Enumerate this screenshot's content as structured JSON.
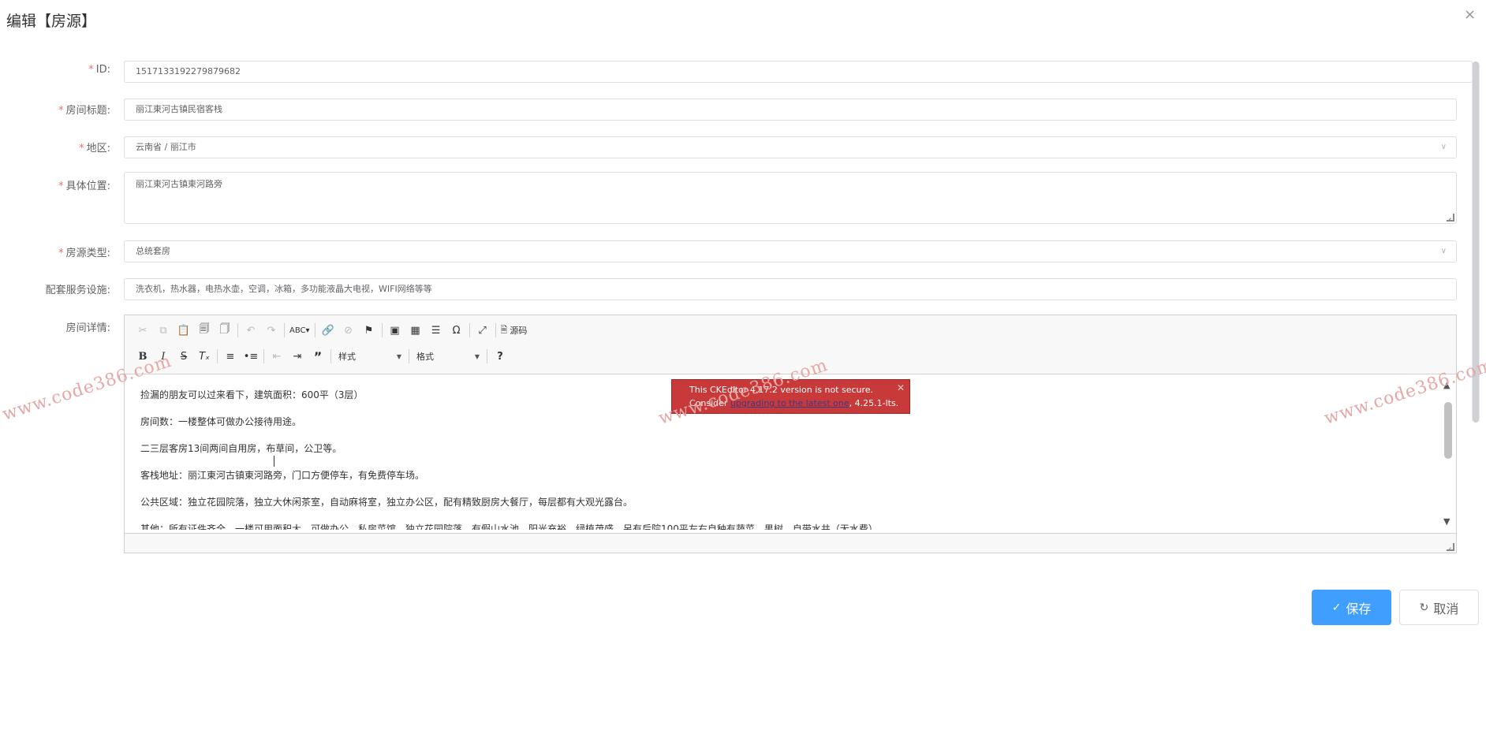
{
  "dialog": {
    "title": "编辑【房源】",
    "close_glyph": "×"
  },
  "form": {
    "required_mark": "*",
    "id": {
      "label": "ID:",
      "value": "1517133192279879682"
    },
    "room_title": {
      "label": "房间标题:",
      "value": "丽江東河古镇民宿客栈"
    },
    "region": {
      "label": "地区:",
      "value": "云南省 / 丽江市"
    },
    "address": {
      "label": "具体位置:",
      "value": "丽江東河古镇東河路旁"
    },
    "room_type": {
      "label": "房源类型:",
      "value": "总统套房"
    },
    "facilities": {
      "label": "配套服务设施:",
      "value": "洗衣机，热水器，电热水壶，空调，冰箱，多功能液晶大电视，WIFI网络等等"
    },
    "details": {
      "label": "房间详情:"
    }
  },
  "editor": {
    "toolbar": {
      "source_label": "源码",
      "styles_label": "样式",
      "format_label": "格式",
      "help_glyph": "?"
    },
    "content_lines": [
      "捡漏的朋友可以过来看下，建筑面积：600平（3层）",
      "房间数：一楼整体可做办公接待用途。",
      "二三层客房13间两间自用房，布草间，公卫等。",
      "客栈地址：丽江東河古镇東河路旁，门口方便停车，有免费停车场。",
      "公共区域：独立花园院落，独立大休闲茶室，自动麻将室，独立办公区，配有精致厨房大餐厅，每层都有大观光露台。",
      "其他：所有证件齐全，一楼可用面积大，可做办公，私房菜馆，独立花园院落，有假山水池，阳光充裕，绿植茂盛，另有后院100平左右自种有蔬菜，果树，自带水井（无水费）"
    ],
    "notice": {
      "line1": "This CKEditor 4.17.2 version is not secure.",
      "line2_prefix": "Consider ",
      "link": "upgrading to the latest one",
      "line2_suffix": ", 4.25.1-lts.",
      "close_glyph": "✕"
    }
  },
  "buttons": {
    "save": "保存",
    "cancel": "取消"
  },
  "watermark": "www.code386.com",
  "icons": {
    "close": "close-icon",
    "dropdown": "chevron-down-icon",
    "save": "check-icon",
    "cancel": "refresh-icon"
  }
}
